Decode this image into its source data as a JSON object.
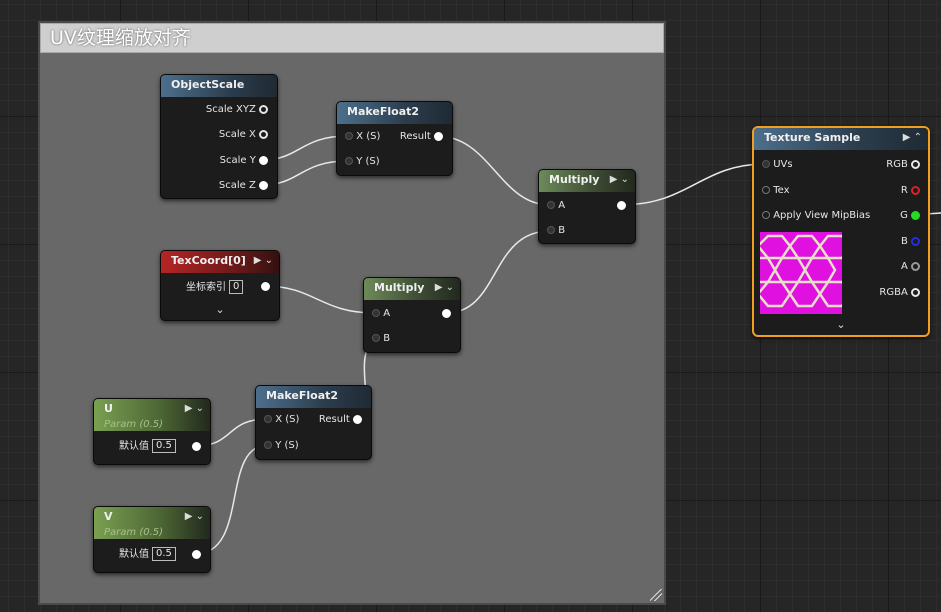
{
  "comment": {
    "title": "UV纹理缩放对齐"
  },
  "nodes": {
    "object_scale": {
      "title": "ObjectScale",
      "outputs": [
        "Scale XYZ",
        "Scale X",
        "Scale Y",
        "Scale Z"
      ]
    },
    "make_float2_top": {
      "title": "MakeFloat2",
      "inputs": [
        "X (S)",
        "Y (S)"
      ],
      "output": "Result"
    },
    "multiply_right": {
      "title": "Multiply",
      "inputs": [
        "A",
        "B"
      ]
    },
    "texcoord": {
      "title": "TexCoord[0]",
      "label": "坐标索引",
      "value": "0"
    },
    "multiply_mid": {
      "title": "Multiply",
      "inputs": [
        "A",
        "B"
      ]
    },
    "make_float2_bottom": {
      "title": "MakeFloat2",
      "inputs": [
        "X (S)",
        "Y (S)"
      ],
      "output": "Result"
    },
    "param_u": {
      "title": "U",
      "subtitle": "Param (0.5)",
      "label": "默认值",
      "value": "0.5"
    },
    "param_v": {
      "title": "V",
      "subtitle": "Param (0.5)",
      "label": "默认值",
      "value": "0.5"
    },
    "texture_sample": {
      "title": "Texture Sample",
      "inputs": [
        "UVs",
        "Tex",
        "Apply View MipBias"
      ],
      "outputs": [
        "RGB",
        "R",
        "G",
        "B",
        "A",
        "RGBA"
      ]
    }
  },
  "icons": {
    "play": "▶",
    "collapse": "⌄",
    "expand": "⌄",
    "expand_up": "⌃"
  },
  "colors": {
    "comment_bg": "#686868",
    "pin_r": "#e02020",
    "pin_g": "#22dd22",
    "pin_b": "#2230d8",
    "selection": "#f0a020",
    "texture": "#e010e0"
  }
}
